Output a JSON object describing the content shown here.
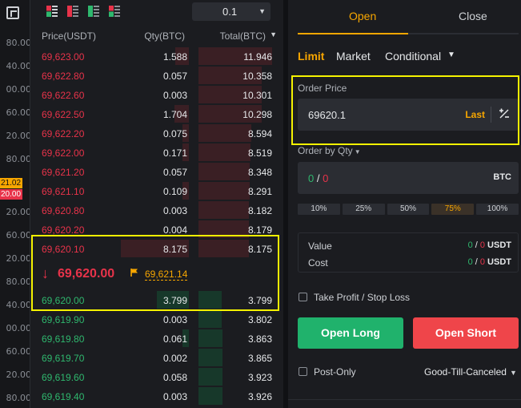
{
  "axis": {
    "ticks": [
      "80.00",
      "40.00",
      "00.00",
      "60.00",
      "20.00",
      "80.00",
      "21.02",
      "20.00",
      "20.00",
      "60.00",
      "20.00",
      "80.00",
      "40.00",
      "00.00",
      "60.00",
      "20.00",
      "80.00"
    ],
    "tag_orange": "21.02",
    "tag_red": "20.00"
  },
  "book": {
    "tick_size": "0.1",
    "headers": {
      "price": "Price(USDT)",
      "qty": "Qty(BTC)",
      "total": "Total(BTC)"
    },
    "asks": [
      {
        "price": "69,623.00",
        "qty": "1.588",
        "total": "11.946"
      },
      {
        "price": "69,622.80",
        "qty": "0.057",
        "total": "10.358"
      },
      {
        "price": "69,622.60",
        "qty": "0.003",
        "total": "10.301"
      },
      {
        "price": "69,622.50",
        "qty": "1.704",
        "total": "10.298"
      },
      {
        "price": "69,622.20",
        "qty": "0.075",
        "total": "8.594"
      },
      {
        "price": "69,622.00",
        "qty": "0.171",
        "total": "8.519"
      },
      {
        "price": "69,621.20",
        "qty": "0.057",
        "total": "8.348"
      },
      {
        "price": "69,621.10",
        "qty": "0.109",
        "total": "8.291"
      },
      {
        "price": "69,620.80",
        "qty": "0.003",
        "total": "8.182"
      },
      {
        "price": "69,620.20",
        "qty": "0.004",
        "total": "8.179"
      },
      {
        "price": "69,620.10",
        "qty": "8.175",
        "total": "8.175"
      }
    ],
    "last_price": "69,620.00",
    "mark_price": "69,621.14",
    "bids": [
      {
        "price": "69,620.00",
        "qty": "3.799",
        "total": "3.799"
      },
      {
        "price": "69,619.90",
        "qty": "0.003",
        "total": "3.802"
      },
      {
        "price": "69,619.80",
        "qty": "0.061",
        "total": "3.863"
      },
      {
        "price": "69,619.70",
        "qty": "0.002",
        "total": "3.865"
      },
      {
        "price": "69,619.60",
        "qty": "0.058",
        "total": "3.923"
      },
      {
        "price": "69,619.40",
        "qty": "0.003",
        "total": "3.926"
      }
    ],
    "colors": {
      "ask": "#e8334a",
      "bid": "#2fb86e"
    }
  },
  "panel": {
    "tabs": {
      "open": "Open",
      "close": "Close"
    },
    "order_types": {
      "limit": "Limit",
      "market": "Market",
      "conditional": "Conditional"
    },
    "order_price_label": "Order Price",
    "order_price_value": "69620.1",
    "last_label": "Last",
    "order_by_label": "Order by Qty",
    "qty_left": "0",
    "qty_sep": " / ",
    "qty_right": "0",
    "qty_unit": "BTC",
    "percents": [
      "10%",
      "25%",
      "50%",
      "75%",
      "100%"
    ],
    "selected_percent": "75%",
    "value_label": "Value",
    "cost_label": "Cost",
    "value_left": "0",
    "value_right": "0",
    "cost_left": "0",
    "cost_right": "0",
    "currency": "USDT",
    "tpsl_label": "Take Profit / Stop Loss",
    "open_long": "Open Long",
    "open_short": "Open Short",
    "post_only": "Post-Only",
    "time_in_force": "Good-Till-Canceled",
    "accent": "#f7a600"
  }
}
